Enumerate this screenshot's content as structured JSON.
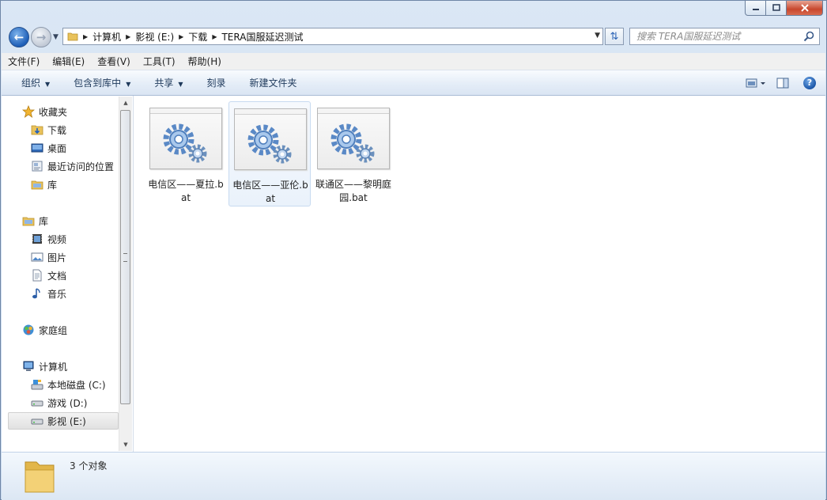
{
  "address": {
    "crumbs": [
      "计算机",
      "影视 (E:)",
      "下载",
      "TERA国服延迟测试"
    ]
  },
  "search": {
    "placeholder": "搜索 TERA国服延迟测试"
  },
  "menu": [
    "文件(F)",
    "编辑(E)",
    "查看(V)",
    "工具(T)",
    "帮助(H)"
  ],
  "toolbar": {
    "organize": "组织",
    "include_library": "包含到库中",
    "share": "共享",
    "burn": "刻录",
    "new_folder": "新建文件夹"
  },
  "sidebar": {
    "favorites": {
      "label": "收藏夹",
      "items": [
        "下载",
        "桌面",
        "最近访问的位置",
        "库"
      ]
    },
    "libraries": {
      "label": "库",
      "items": [
        "视频",
        "图片",
        "文档",
        "音乐"
      ]
    },
    "homegroup": {
      "label": "家庭组"
    },
    "computer": {
      "label": "计算机",
      "items": [
        "本地磁盘 (C:)",
        "游戏 (D:)",
        "影视 (E:)"
      ]
    }
  },
  "files": [
    {
      "name": "电信区——夏拉.bat"
    },
    {
      "name": "电信区——亚伦.bat"
    },
    {
      "name": "联通区——黎明庭园.bat"
    }
  ],
  "status": {
    "count": "3 个对象"
  },
  "icons": {
    "back": "back-arrow-icon",
    "forward": "forward-arrow-icon",
    "gear": "gears-icon",
    "help": "help-icon"
  }
}
